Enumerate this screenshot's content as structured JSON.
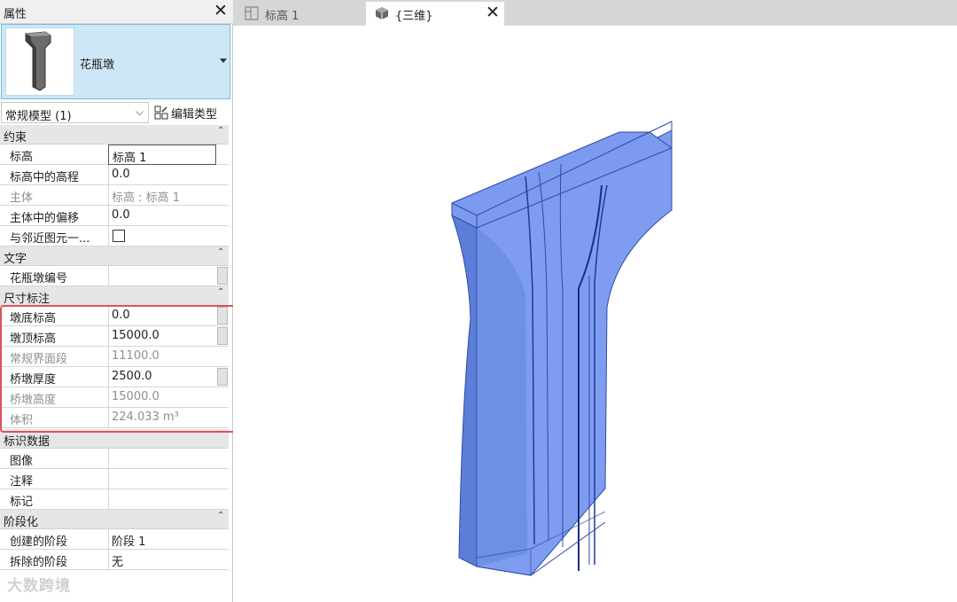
{
  "properties": {
    "title": "属性",
    "type_name": "花瓶墩",
    "filter_value": "常规模型 (1)",
    "edit_type_label": "编辑类型",
    "sections": {
      "constraints": "约束",
      "text": "文字",
      "dimensions": "尺寸标注",
      "identity": "标识数据",
      "phasing": "阶段化"
    },
    "rows": {
      "level": {
        "name": "标高",
        "value": "标高 1"
      },
      "elev_from_level": {
        "name": "标高中的高程",
        "value": "0.0"
      },
      "host": {
        "name": "主体",
        "value": "标高 : 标高 1"
      },
      "offset_from_host": {
        "name": "主体中的偏移",
        "value": "0.0"
      },
      "move_with_nearby": {
        "name": "与邻近图元一..."
      },
      "pier_number": {
        "name": "花瓶墩编号",
        "value": ""
      },
      "pier_bottom": {
        "name": "墩底标高",
        "value": "0.0"
      },
      "pier_top": {
        "name": "墩顶标高",
        "value": "15000.0"
      },
      "normal_section": {
        "name": "常规界面段",
        "value": "11100.0"
      },
      "pier_thickness": {
        "name": "桥墩厚度",
        "value": "2500.0"
      },
      "pier_height": {
        "name": "桥墩高度",
        "value": "15000.0"
      },
      "volume": {
        "name": "体积",
        "value": "224.033 m³"
      },
      "image": {
        "name": "图像",
        "value": ""
      },
      "comments": {
        "name": "注释",
        "value": ""
      },
      "mark": {
        "name": "标记",
        "value": ""
      },
      "phase_created": {
        "name": "创建的阶段",
        "value": "阶段 1"
      },
      "phase_demolished": {
        "name": "拆除的阶段",
        "value": "无"
      }
    }
  },
  "tabs": [
    {
      "label": "标高 1"
    },
    {
      "label": "{三维}"
    }
  ],
  "watermark": "大数跨境",
  "colors": {
    "selector_bg": "#cde7f7",
    "model_face": "#6f8fe8",
    "highlight_border": "#e0515a"
  }
}
